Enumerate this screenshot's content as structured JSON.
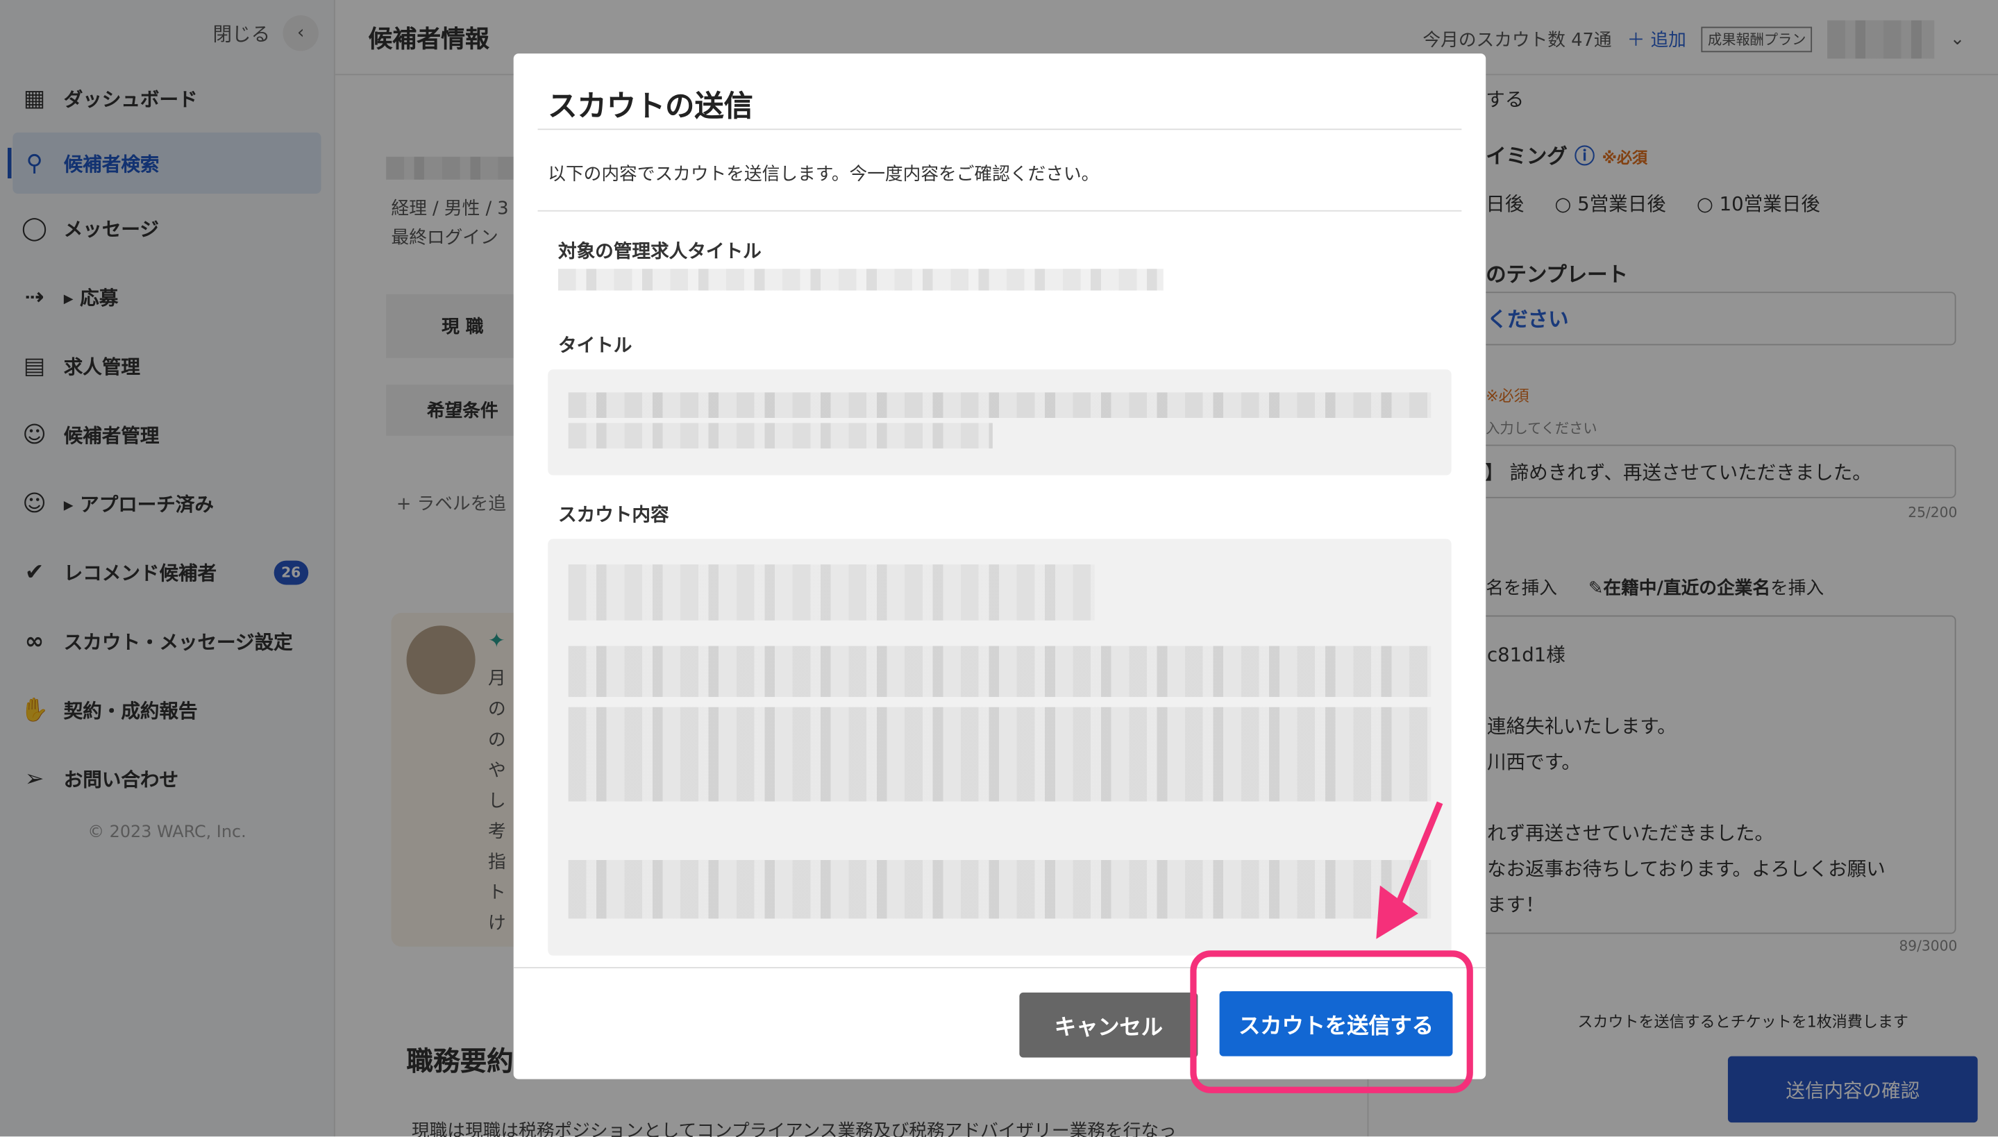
{
  "sidebar": {
    "close_label": "閉じる",
    "items": [
      {
        "label": "ダッシュボード",
        "icon": "dashboard-icon"
      },
      {
        "label": "候補者検索",
        "icon": "search-icon",
        "active": true
      },
      {
        "label": "メッセージ",
        "icon": "chat-icon"
      },
      {
        "label": "▸ 応募",
        "icon": "applicant-icon"
      },
      {
        "label": "求人管理",
        "icon": "document-icon"
      },
      {
        "label": "候補者管理",
        "icon": "users-icon"
      },
      {
        "label": "▸ アプローチ済み",
        "icon": "approached-icon"
      },
      {
        "label": "レコメンド候補者",
        "icon": "verified-icon",
        "badge": "26"
      },
      {
        "label": "スカウト・メッセージ設定",
        "icon": "settings-link-icon"
      },
      {
        "label": "契約・成約報告",
        "icon": "clap-icon"
      },
      {
        "label": "お問い合わせ",
        "icon": "paper-plane-icon"
      }
    ],
    "copyright": "© 2023 WARC, Inc."
  },
  "header": {
    "title": "候補者情報",
    "scout_count": "今月のスカウト数 47通",
    "add_label": "追加",
    "plan_label": "成果報酬プラン"
  },
  "main": {
    "profile_meta": "経理 / 男性 / 3",
    "last_login": "最終ログイン",
    "tab_current": "現 職",
    "tab_desired": "希望条件",
    "add_label": "+ ラベルを追",
    "section_title": "職務要約",
    "summary_text": "現職は現職は税務ポジションとしてコンプライアンス業務及び税務アドバイザリー業務を行なっ",
    "note_lines": [
      "月",
      "の",
      "の",
      "や",
      "し",
      "考",
      "指",
      "ト",
      "け"
    ]
  },
  "right": {
    "line1": "する",
    "timing_label": "イミング",
    "required": "※必須",
    "opt1": "日後",
    "opt2": "5営業日後",
    "opt3": "10営業日後",
    "template_label": "のテンプレート",
    "template_placeholder": "ください",
    "required2": "※必須",
    "hint": "入力してください",
    "subject_value": "】 諦めきれず、再送させていただきました。",
    "subject_count": "25/200",
    "insert1": "名を挿入",
    "insert2_bold": "在籍中/直近の企業名",
    "insert2_rest": "を挿入",
    "body_lines": [
      "c81d1様",
      "",
      "連絡失礼いたします。",
      "川西です。",
      "",
      "れず再送させていただきました。",
      "なお返事お待ちしております。よろしくお願い",
      "ます！"
    ],
    "body_count": "89/3000",
    "ticket_note": "スカウトを送信するとチケットを1枚消費します",
    "confirm_button": "送信内容の確認"
  },
  "modal": {
    "title": "スカウトの送信",
    "description": "以下の内容でスカウトを送信します。今一度内容をご確認ください。",
    "job_title_label": "対象の管理求人タイトル",
    "title_label": "タイトル",
    "content_label": "スカウト内容",
    "cancel_button": "キャンセル",
    "send_button": "スカウトを送信する"
  },
  "colors": {
    "accent": "#1267d3",
    "highlight": "#f5307a",
    "required": "#e07020"
  }
}
